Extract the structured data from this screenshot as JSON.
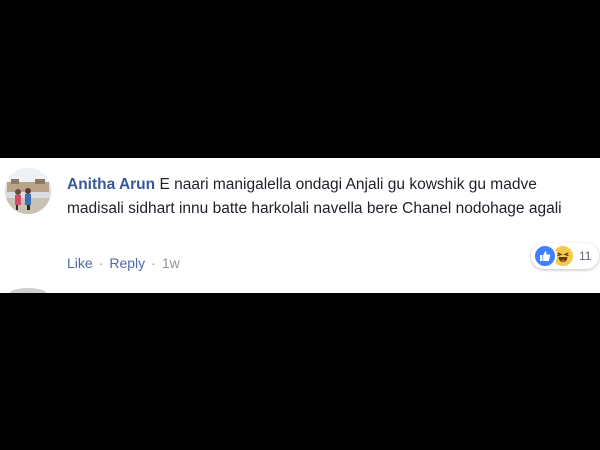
{
  "comment": {
    "author": "Anitha Arun",
    "text": "E naari manigalella ondagi Anjali gu kowshik gu madve madisali sidhart innu batte harkolali navella bere Chanel nodohage agali",
    "actions": {
      "like_label": "Like",
      "separator": "·",
      "reply_label": "Reply",
      "timestamp": "1w"
    },
    "reactions": {
      "icons": [
        "like-icon",
        "haha-icon"
      ],
      "count": "11"
    }
  },
  "colors": {
    "background": "#000000",
    "panel": "#ffffff",
    "author_link": "#385898",
    "action_link": "#4b6aa7",
    "like_blue": "#4080ff",
    "haha_yellow": "#f7c94b"
  }
}
